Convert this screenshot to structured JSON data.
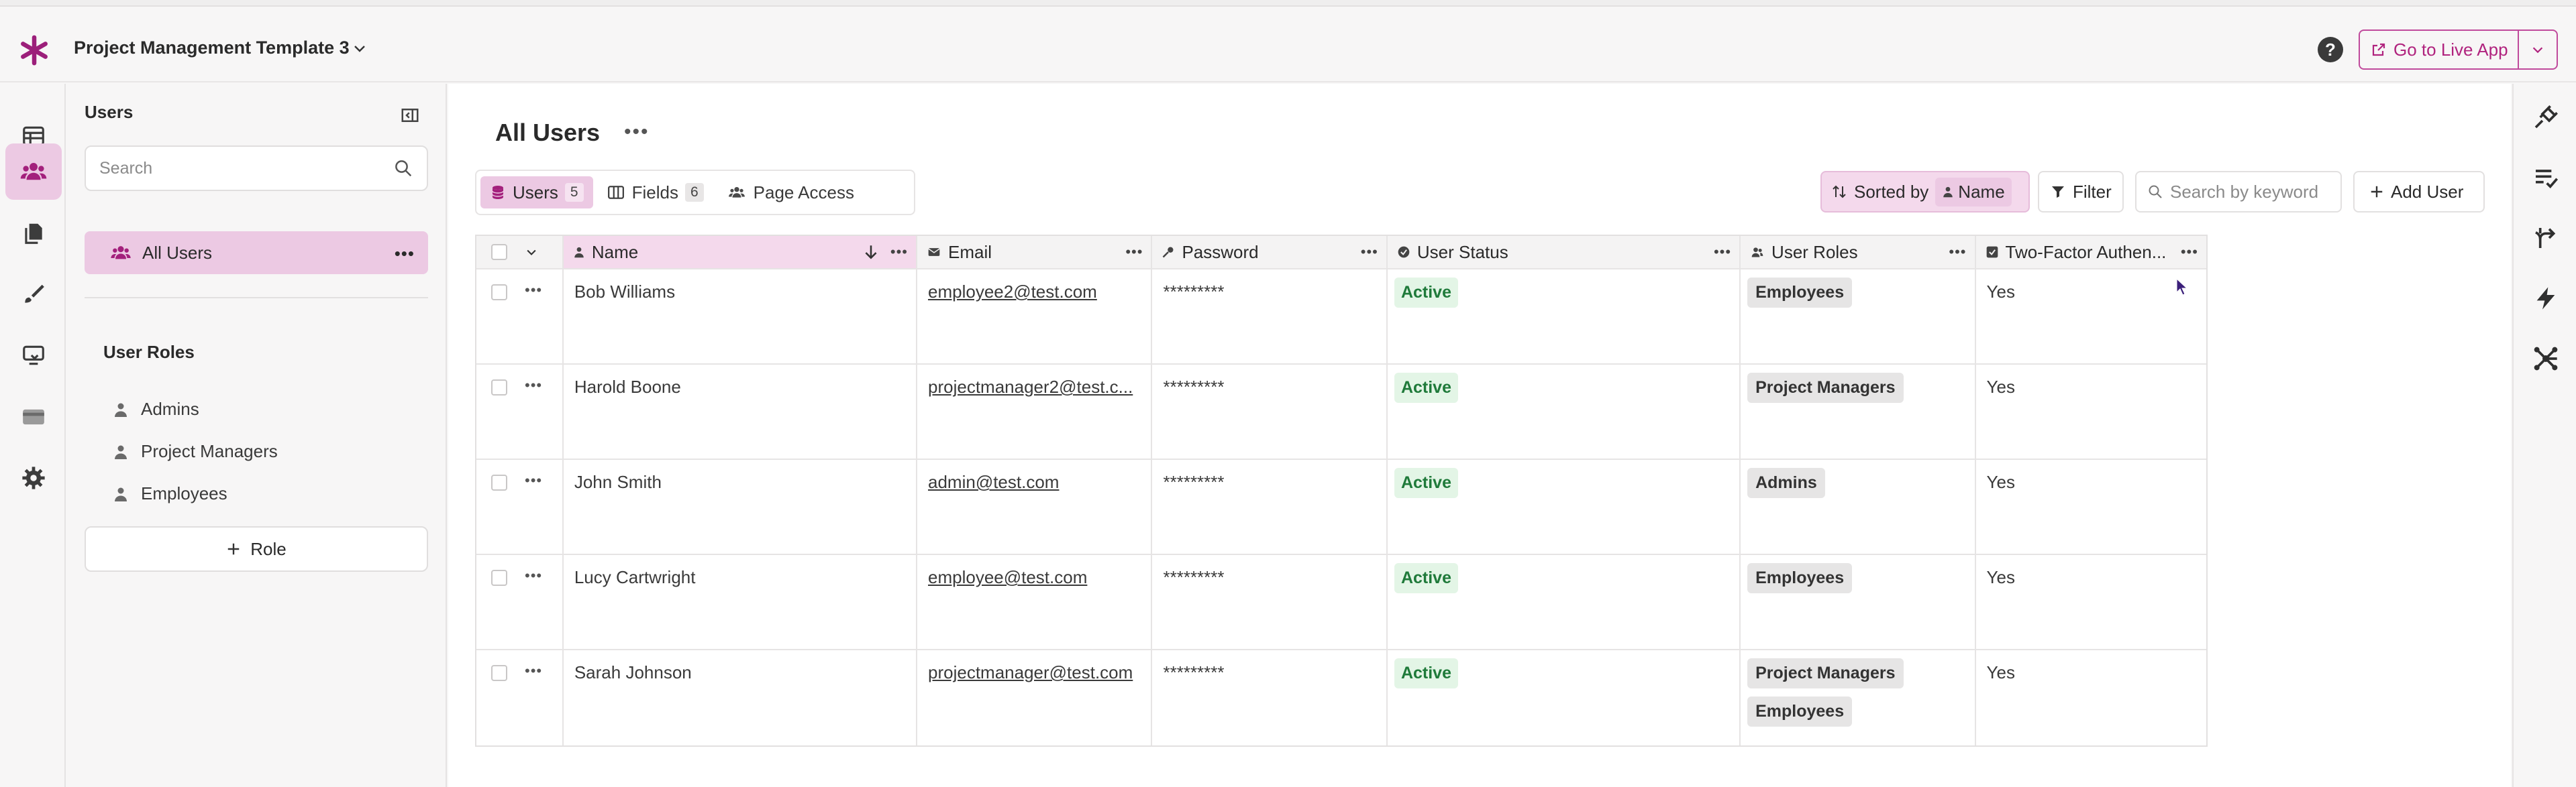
{
  "app": {
    "name": "Project Management Template 3",
    "live_button": "Go to Live App",
    "colors": {
      "accent": "#a3207c",
      "accent_bg": "#ecc9e3",
      "active_green": "#1f7a3a"
    }
  },
  "left_nav": {
    "items": [
      {
        "icon": "table-icon"
      },
      {
        "icon": "users-icon"
      },
      {
        "icon": "documents-icon"
      },
      {
        "icon": "brush-icon"
      },
      {
        "icon": "automation-icon"
      },
      {
        "icon": "card-icon"
      },
      {
        "icon": "gear-icon"
      }
    ]
  },
  "sidebar": {
    "title": "Users",
    "search_placeholder": "Search",
    "all_users": "All Users",
    "roles_heading": "User Roles",
    "roles": [
      "Admins",
      "Project Managers",
      "Employees"
    ],
    "add_role": "Role"
  },
  "main": {
    "title": "All Users",
    "tabs": [
      {
        "label": "Users",
        "count": "5"
      },
      {
        "label": "Fields",
        "count": "6"
      },
      {
        "label": "Page Access"
      }
    ],
    "toolbar": {
      "sorted_by": "Sorted by",
      "sort_field": "Name",
      "filter": "Filter",
      "search_placeholder": "Search by keyword",
      "add_user": "Add User"
    },
    "columns": [
      "Name",
      "Email",
      "Password",
      "User Status",
      "User Roles",
      "Two-Factor Authen..."
    ],
    "rows": [
      {
        "name": "Bob Williams",
        "email": "employee2@test.com",
        "password": "*********",
        "status": "Active",
        "roles": [
          "Employees"
        ],
        "two_factor": "Yes"
      },
      {
        "name": "Harold Boone",
        "email": "projectmanager2@test.c...",
        "password": "*********",
        "status": "Active",
        "roles": [
          "Project Managers"
        ],
        "two_factor": "Yes"
      },
      {
        "name": "John Smith",
        "email": "admin@test.com",
        "password": "*********",
        "status": "Active",
        "roles": [
          "Admins"
        ],
        "two_factor": "Yes"
      },
      {
        "name": "Lucy Cartwright",
        "email": "employee@test.com",
        "password": "*********",
        "status": "Active",
        "roles": [
          "Employees"
        ],
        "two_factor": "Yes"
      },
      {
        "name": "Sarah Johnson",
        "email": "projectmanager@test.com",
        "password": "*********",
        "status": "Active",
        "roles": [
          "Project Managers",
          "Employees"
        ],
        "two_factor": "Yes"
      }
    ]
  },
  "right_nav": {
    "items": [
      {
        "icon": "plug-icon"
      },
      {
        "icon": "checklist-icon"
      },
      {
        "icon": "branch-icon"
      },
      {
        "icon": "lightning-icon"
      },
      {
        "icon": "network-icon"
      }
    ]
  }
}
